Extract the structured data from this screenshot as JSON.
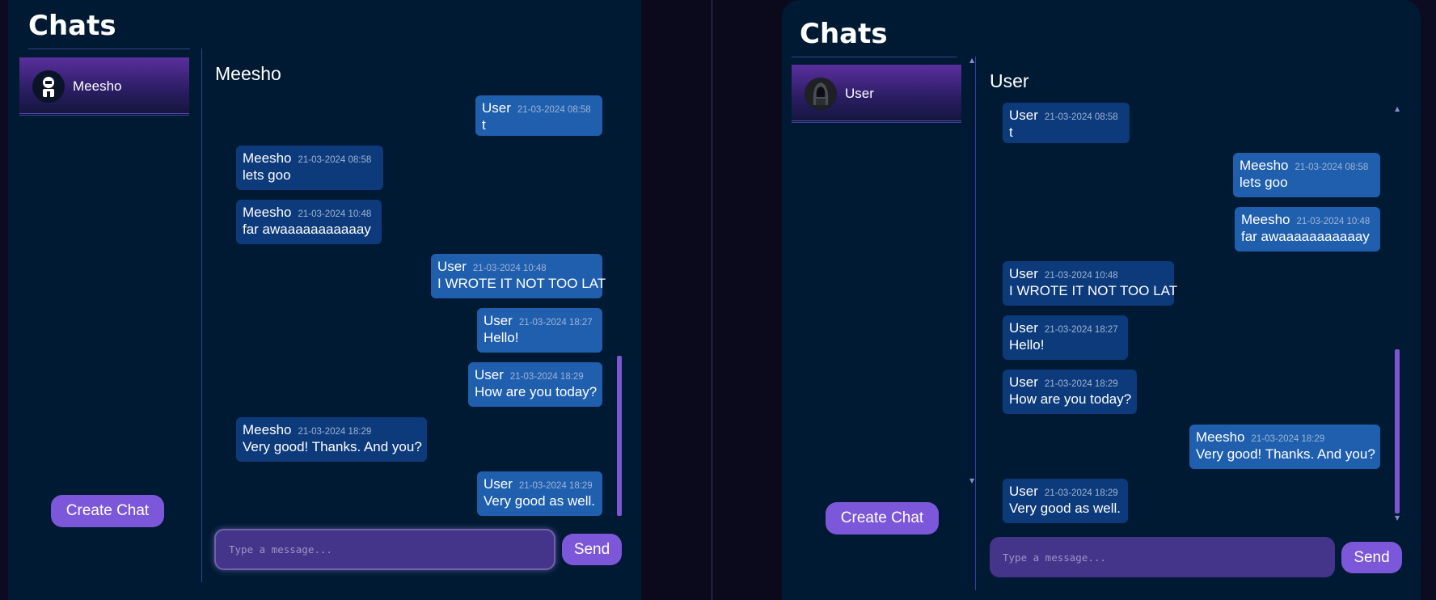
{
  "left_panel": {
    "sidebar_title": "Chats",
    "chats": [
      {
        "name": "Meesho",
        "avatar": "robot-avatar"
      }
    ],
    "create_label": "Create Chat",
    "conversation_title": "Meesho",
    "messages": [
      {
        "sender": "User",
        "time": "21-03-2024 08:58",
        "text": "t"
      },
      {
        "sender": "Meesho",
        "time": "21-03-2024 08:58",
        "text": "lets goo"
      },
      {
        "sender": "Meesho",
        "time": "21-03-2024 10:48",
        "text": "far awaaaaaaaaaaay"
      },
      {
        "sender": "User",
        "time": "21-03-2024 10:48",
        "text": "I WROTE IT NOT TOO LAT"
      },
      {
        "sender": "User",
        "time": "21-03-2024 18:27",
        "text": "Hello!"
      },
      {
        "sender": "User",
        "time": "21-03-2024 18:29",
        "text": "How are you today?"
      },
      {
        "sender": "Meesho",
        "time": "21-03-2024 18:29",
        "text": "Very good! Thanks. And you?"
      },
      {
        "sender": "User",
        "time": "21-03-2024 18:29",
        "text": "Very good as well."
      }
    ],
    "input_placeholder": "Type a message...",
    "send_label": "Send"
  },
  "right_panel": {
    "sidebar_title": "Chats",
    "chats": [
      {
        "name": "User",
        "avatar": "hooded-figure-avatar"
      }
    ],
    "create_label": "Create Chat",
    "conversation_title": "User",
    "messages": [
      {
        "sender": "User",
        "time": "21-03-2024 08:58",
        "text": "t"
      },
      {
        "sender": "Meesho",
        "time": "21-03-2024 08:58",
        "text": "lets goo"
      },
      {
        "sender": "Meesho",
        "time": "21-03-2024 10:48",
        "text": "far awaaaaaaaaaaay"
      },
      {
        "sender": "User",
        "time": "21-03-2024 10:48",
        "text": "I WROTE IT NOT TOO LAT"
      },
      {
        "sender": "User",
        "time": "21-03-2024 18:27",
        "text": "Hello!"
      },
      {
        "sender": "User",
        "time": "21-03-2024 18:29",
        "text": "How are you today?"
      },
      {
        "sender": "Meesho",
        "time": "21-03-2024 18:29",
        "text": "Very good! Thanks. And you?"
      },
      {
        "sender": "User",
        "time": "21-03-2024 18:29",
        "text": "Very good as well."
      }
    ],
    "input_placeholder": "Type a message...",
    "send_label": "Send"
  },
  "colors": {
    "panel_bg": "#001a33",
    "outgoing_bubble": "#1f5fae",
    "incoming_bubble": "#0d3a7a",
    "accent_purple": "#7d57d9",
    "input_bg": "#44348a"
  }
}
